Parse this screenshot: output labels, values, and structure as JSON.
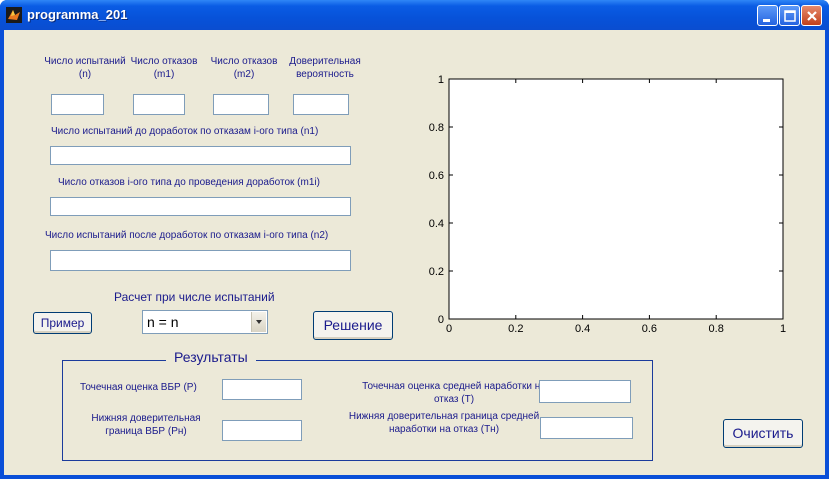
{
  "window": {
    "title": "programma_201"
  },
  "inputs_top": {
    "n_label": "Число испытаний (n)",
    "m1_label": "Число отказов (m1)",
    "m2_label": "Число отказов (m2)",
    "conf_label": "Доверительная вероятность",
    "n_value": "",
    "m1_value": "",
    "m2_value": "",
    "conf_value": ""
  },
  "inputs_wide": {
    "n1_label": "Число испытаний до доработок по отказам i-ого типа  (n1)",
    "m1i_label": "Число отказов i-ого типа до проведения доработок (m1i)",
    "n2_label": "Число испытаний  после доработок по отказам i-ого типа (n2)",
    "n1_value": "",
    "m1i_value": "",
    "n2_value": ""
  },
  "controls": {
    "example_button": "Пример",
    "calc_label": "Расчет при числе испытаний",
    "calc_select_value": "n = n",
    "solve_button": "Решение",
    "clear_button": "Очистить"
  },
  "results": {
    "group_title": "Результаты",
    "p_label": "Точечная оценка ВБР (P)",
    "pn_label": "Нижняя доверительная граница ВБР (Pн)",
    "t_label": "Точечная оценка средней наработки на отказ  (T)",
    "tn_label": "Нижняя доверительная граница средней наработки на отказ  (Tн)",
    "p_value": "",
    "pn_value": "",
    "t_value": "",
    "tn_value": ""
  },
  "chart_data": {
    "type": "line",
    "series": [],
    "xlim": [
      0,
      1
    ],
    "ylim": [
      0,
      1
    ],
    "x_ticks": [
      "0",
      "0.2",
      "0.4",
      "0.6",
      "0.8",
      "1"
    ],
    "y_ticks": [
      "0",
      "0.2",
      "0.4",
      "0.6",
      "0.8",
      "1"
    ],
    "grid": false
  },
  "colors": {
    "label_text": "#1a1a8c",
    "title_bar": "#0a4fd8",
    "client_bg": "#ece9d8"
  }
}
